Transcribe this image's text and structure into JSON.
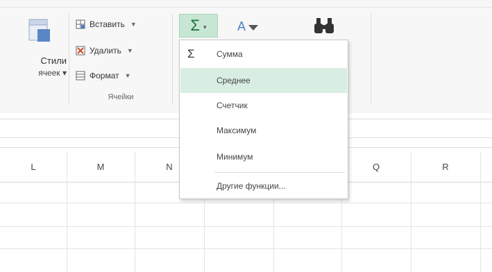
{
  "ribbon": {
    "cell_styles": {
      "line1": "Стили",
      "line2": "ячеек ▾"
    },
    "cells_group": {
      "insert_label": "Вставить",
      "delete_label": "Удалить",
      "format_label": "Формат",
      "group_label": "Ячейки"
    },
    "autosum": {
      "symbol": "Σ",
      "caret": "▾"
    }
  },
  "autosum_menu": {
    "items": [
      {
        "label": "Сумма",
        "icon": "sigma-icon",
        "glyph": "Σ"
      },
      {
        "label": "Среднее"
      },
      {
        "label": "Счетчик"
      },
      {
        "label": "Максимум"
      },
      {
        "label": "Минимум"
      },
      {
        "label": "Другие функции..."
      }
    ],
    "highlighted_item": "Среднее",
    "highlight_color": "#d9eee2"
  },
  "grid": {
    "columns": [
      "L",
      "M",
      "N",
      "Q",
      "R"
    ]
  },
  "colors": {
    "accent": "#1e6e3b",
    "button_active_bg": "#c7e6d3"
  }
}
